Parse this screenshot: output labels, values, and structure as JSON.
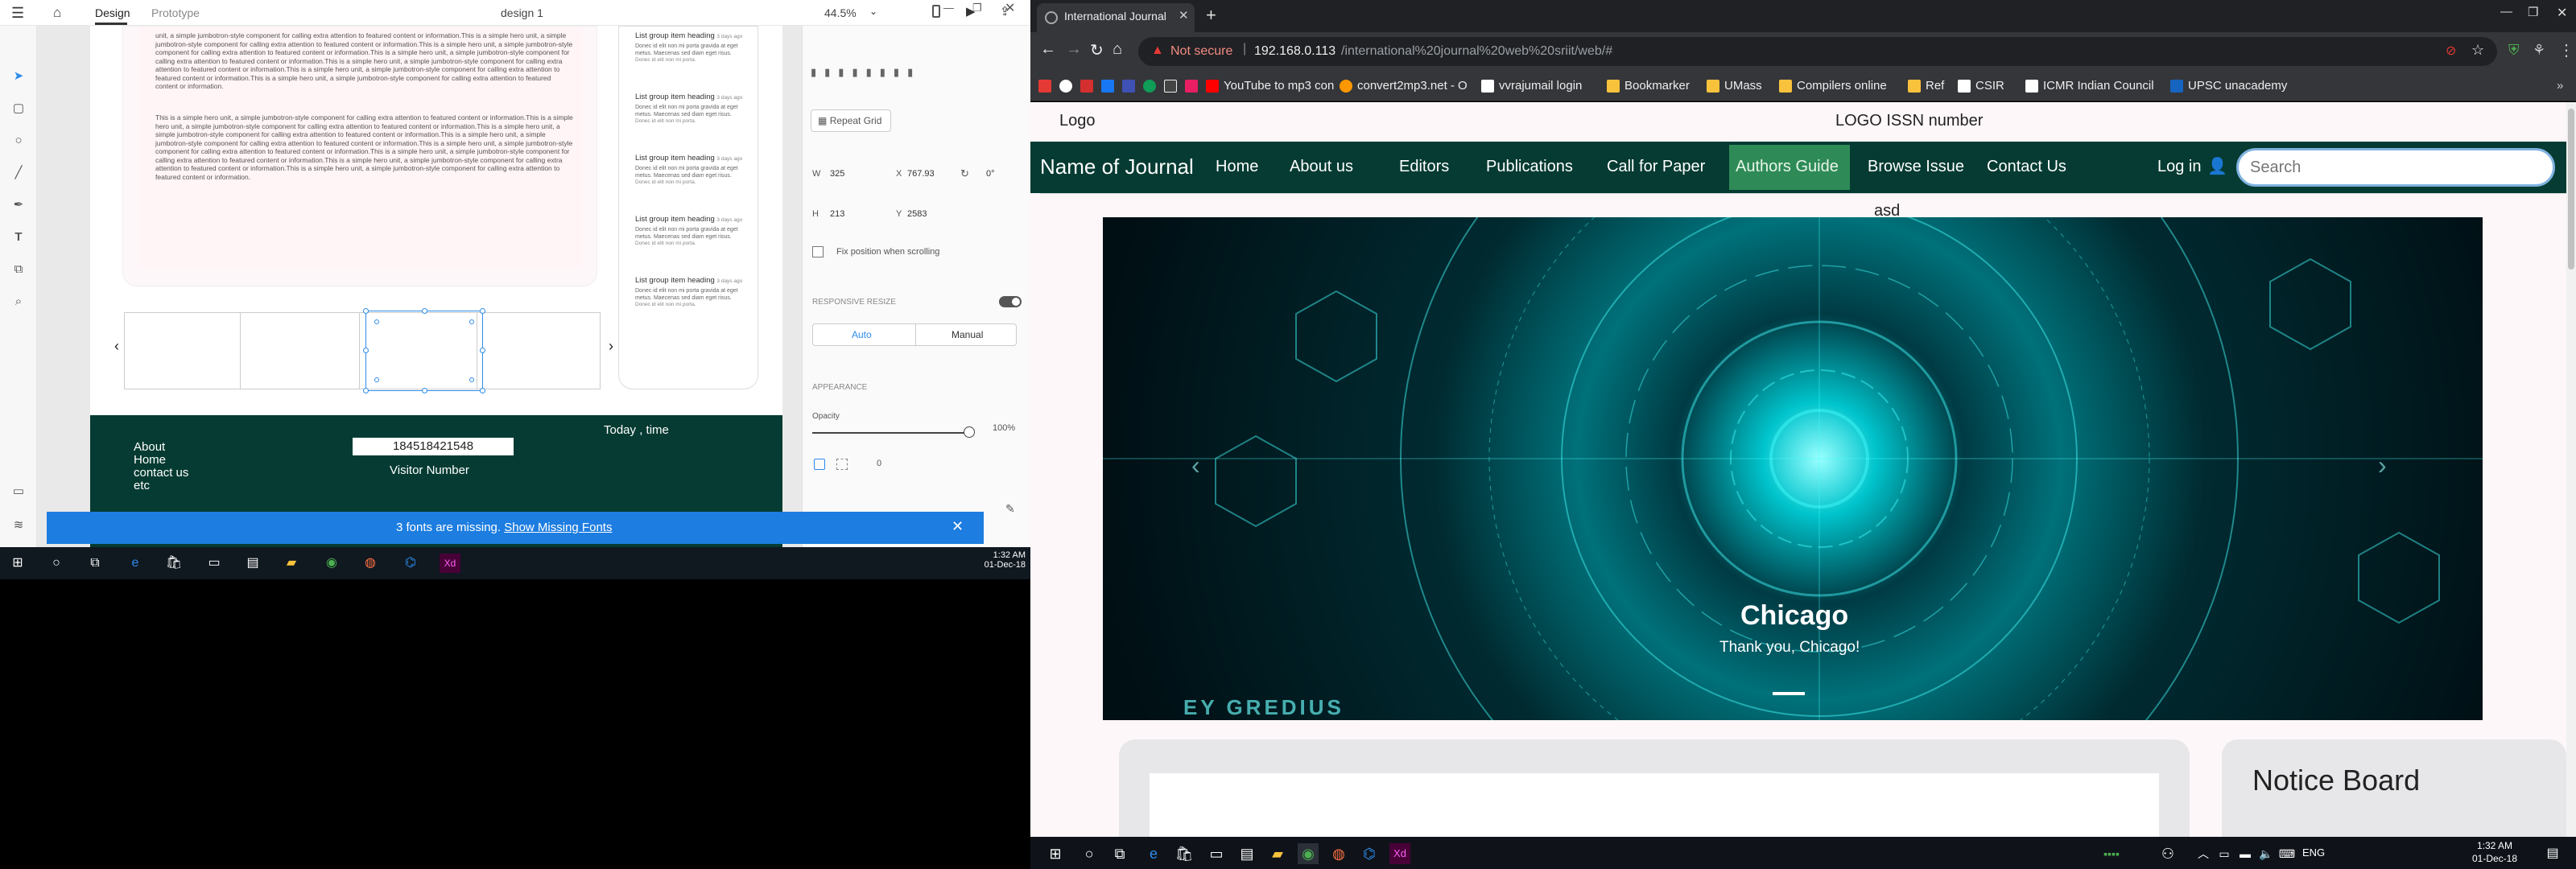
{
  "xd": {
    "tabs": {
      "design": "Design",
      "prototype": "Prototype"
    },
    "doc_title": "design 1",
    "zoom": "44.5%",
    "lorem_block_1": "unit, a simple jumbotron-style component for calling extra attention to featured content or information.This is a simple hero unit, a simple jumbotron-style component for calling extra attention to featured content or information.This is a simple hero unit, a simple jumbotron-style component for calling extra attention to featured content or information.This is a simple hero unit, a simple jumbotron-style component for calling extra attention to featured content or information.This is a simple hero unit, a simple jumbotron-style component for calling extra attention to featured content or information.This is a simple hero unit, a simple jumbotron-style component for calling extra attention to featured content or information.This is a simple hero unit, a simple jumbotron-style component for calling extra attention to featured content or information.",
    "lorem_block_2": "This is a simple hero unit, a simple jumbotron-style component for calling extra attention to featured content or information.This is a simple hero unit, a simple jumbotron-style component for calling extra attention to featured content or information.This is a simple hero unit, a simple jumbotron-style component for calling extra attention to featured content or information.This is a simple hero unit, a simple jumbotron-style component for calling extra attention to featured content or information.This is a simple hero unit, a simple jumbotron-style component for calling extra attention to featured content or information.This is a simple hero unit, a simple jumbotron-style component for calling extra attention to featured content or information.This is a simple hero unit, a simple jumbotron-style component for calling extra attention to featured content or information.This is a simple hero unit, a simple jumbotron-style component for calling extra attention to featured content or information.",
    "list_group": [
      {
        "heading": "List group item heading",
        "time": "3 days ago",
        "body": "Donec id elit non mi porta gravida at eget metus. Maecenas sed diam eget risus.",
        "small": "Donec id elit non mi porta."
      },
      {
        "heading": "List group item heading",
        "time": "3 days ago",
        "body": "Donec id elit non mi porta gravida at eget metus. Maecenas sed diam eget risus.",
        "small": "Donec id elit non mi porta."
      },
      {
        "heading": "List group item heading",
        "time": "3 days ago",
        "body": "Donec id elit non mi porta gravida at eget metus. Maecenas sed diam eget risus.",
        "small": "Donec id elit non mi porta."
      },
      {
        "heading": "List group item heading",
        "time": "3 days ago",
        "body": "Donec id elit non mi porta gravida at eget metus. Maecenas sed diam eget risus.",
        "small": "Donec id elit non mi porta."
      },
      {
        "heading": "List group item heading",
        "time": "3 days ago",
        "body": "Donec id elit non mi porta gravida at eget metus. Maecenas sed diam eget risus.",
        "small": "Donec id elit non mi porta."
      }
    ],
    "footer": {
      "links": [
        "About",
        "Home",
        "contact us",
        "etc"
      ],
      "visitor_count": "184518421548",
      "visitor_label": "Visitor Number",
      "today": "Today , time"
    },
    "props": {
      "repeat_grid": "Repeat Grid",
      "w_label": "W",
      "w": "325",
      "x_label": "X",
      "x": "767.93",
      "rotation": "0°",
      "h_label": "H",
      "h": "213",
      "y_label": "Y",
      "y": "2583",
      "fix_position": "Fix position when scrolling",
      "responsive_resize": "RESPONSIVE RESIZE",
      "auto": "Auto",
      "manual": "Manual",
      "appearance": "APPEARANCE",
      "opacity_label": "Opacity",
      "opacity": "100%",
      "opacity_value": 1.0,
      "radius": "0"
    },
    "notification": {
      "text": "3 fonts are missing.",
      "link": "Show Missing Fonts"
    },
    "clock": {
      "time": "1:32 AM",
      "date": "01-Dec-18"
    }
  },
  "chrome": {
    "tab_title": "International Journal",
    "security": "Not secure",
    "url_host": "192.168.0.113",
    "url_path": "/international%20journal%20web%20sriit/web/#",
    "bookmarks": [
      {
        "label": "",
        "color": "#e53935"
      },
      {
        "label": "",
        "color": "#ffffff"
      },
      {
        "label": "",
        "color": "#d32f2f"
      },
      {
        "label": "",
        "color": "#1877f2"
      },
      {
        "label": "",
        "color": "#3f51b5"
      },
      {
        "label": "",
        "color": "#0f9d58"
      },
      {
        "label": "",
        "color": "#444444"
      },
      {
        "label": "",
        "color": "#e91e63"
      },
      {
        "label": "YouTube to mp3 con",
        "color": "#ff0000"
      },
      {
        "label": "convert2mp3.net - O",
        "color": "#ff9800"
      },
      {
        "label": "vvrajumail login",
        "color": "#ffffff"
      },
      {
        "label": "Bookmarker",
        "color": "#f9c23c"
      },
      {
        "label": "UMass",
        "color": "#f9c23c"
      },
      {
        "label": "Compilers online",
        "color": "#f9c23c"
      },
      {
        "label": "Ref",
        "color": "#f9c23c"
      },
      {
        "label": "CSIR",
        "color": "#ffffff"
      },
      {
        "label": "ICMR Indian Council",
        "color": "#ffffff"
      },
      {
        "label": "UPSC unacademy",
        "color": "#1565c0"
      }
    ],
    "page": {
      "logo": "Logo",
      "logo_issn": "LOGO ISSN number",
      "brand": "Name of Journal",
      "nav": [
        "Home",
        "About us",
        "Editors",
        "Publications",
        "Call for Paper",
        "Authors Guide",
        "Browse Issue",
        "Contact Us"
      ],
      "login": "Log in",
      "search_placeholder": "Search",
      "subheading": "asd",
      "carousel": {
        "title": "Chicago",
        "caption": "Thank you, Chicago!",
        "watermark": "EY GREDIUS"
      },
      "notice_board": "Notice Board"
    },
    "clock": {
      "time": "1:32 AM",
      "date": "01-Dec-18"
    },
    "lang": "ENG"
  },
  "colors": {
    "footer_green": "#053b32",
    "nav_active": "#2e8b57",
    "notif_blue": "#1d7de0",
    "selection_blue": "#2d8ceb"
  }
}
